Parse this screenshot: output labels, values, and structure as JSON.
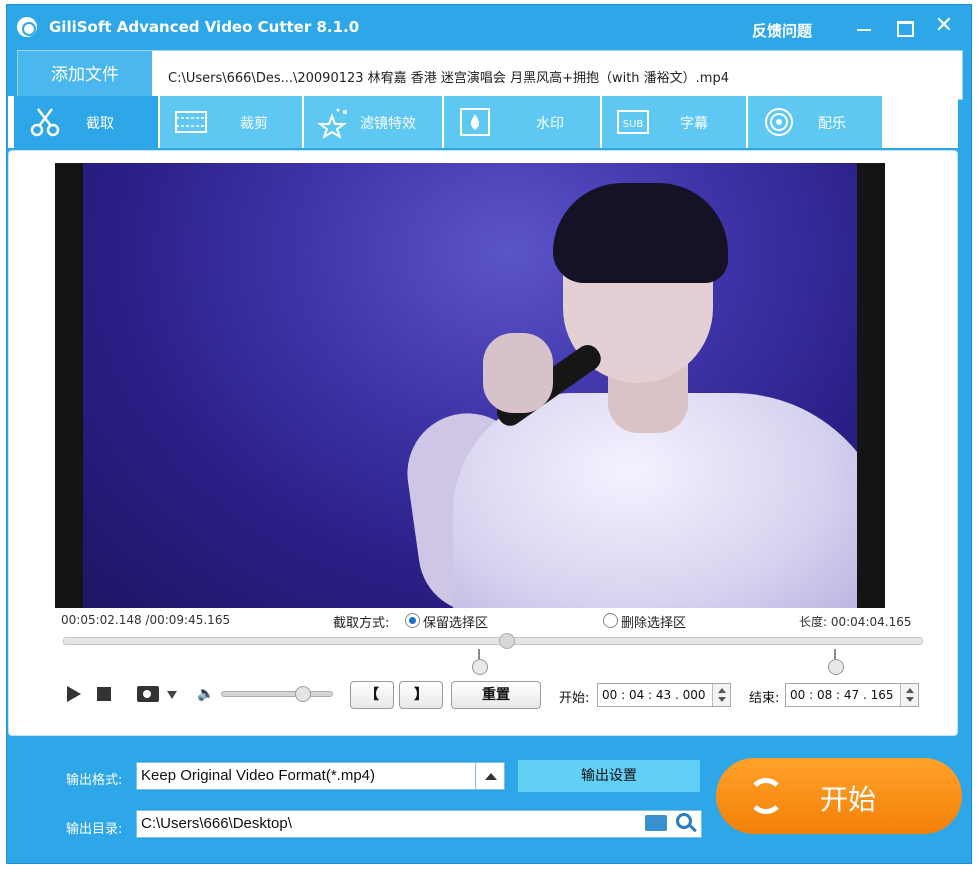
{
  "title_bar": {
    "app_title": "GiliSoft Advanced Video Cutter 8.1.0",
    "feedback_label": "反馈问题",
    "close_glyph": "✕"
  },
  "file_bar": {
    "add_file_label": "添加文件",
    "file_path": "C:\\Users\\666\\Des...\\20090123  林宥嘉 香港 迷宫演唱会 月黑风高+拥抱（with 潘裕文）.mp4"
  },
  "tabs": [
    {
      "label": "截取",
      "icon": "scissors-icon",
      "active": true
    },
    {
      "label": "裁剪",
      "icon": "film-crop-icon",
      "active": false
    },
    {
      "label": "滤镜特效",
      "icon": "stars-icon",
      "active": false
    },
    {
      "label": "水印",
      "icon": "water-drop-icon",
      "active": false
    },
    {
      "label": "字幕",
      "icon": "subtitle-icon",
      "active": false
    },
    {
      "label": "配乐",
      "icon": "music-icon",
      "active": false
    }
  ],
  "player": {
    "current_time": "00:05:02.148 /00:09:45.165",
    "cut_mode_label": "截取方式:",
    "keep_label": "保留选择区",
    "delete_label": "删除选择区",
    "keep_selected": true,
    "length": "长度: 00:04:04.165",
    "speaker_glyph": "🔈",
    "bracket_open": "【",
    "bracket_close": "】",
    "reset_label": "重置",
    "start_label": "开始:",
    "start_time": "00 : 04 : 43 . 000",
    "end_label": "结束:",
    "end_time": "00 : 08 : 47 . 165"
  },
  "output": {
    "format_label": "输出格式:",
    "format_value": "Keep Original Video Format(*.mp4)",
    "settings_label": "输出设置",
    "dir_label": "输出目录:",
    "dir_value": "C:\\Users\\666\\Desktop\\",
    "start_button": "开始"
  },
  "colors": {
    "accent": "#2ea7e8",
    "tab": "#5ec8f3",
    "start": "#f68a10"
  }
}
